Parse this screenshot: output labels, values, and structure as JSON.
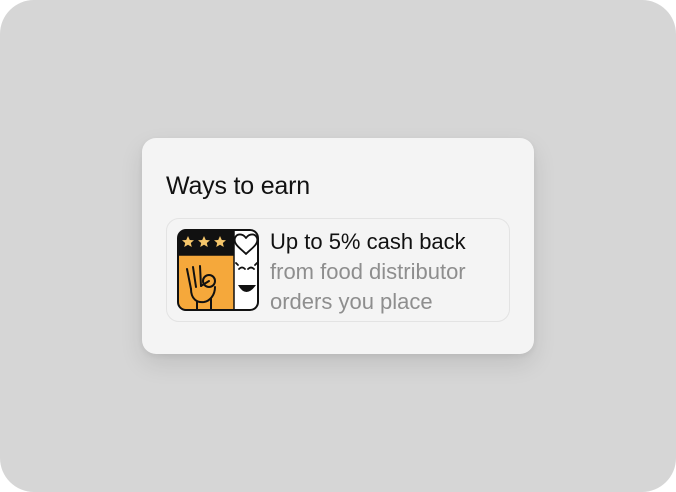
{
  "card": {
    "title": "Ways to earn"
  },
  "earn_item": {
    "headline": "Up to 5% cash back",
    "description": "from food distributor orders you place",
    "icon": "ok-hand-stars-heart-icon"
  },
  "colors": {
    "background": "#d6d6d6",
    "card": "#f4f4f4",
    "accent_orange": "#f5a83b",
    "title_text": "#111111",
    "muted_text": "#8e8e8e"
  }
}
